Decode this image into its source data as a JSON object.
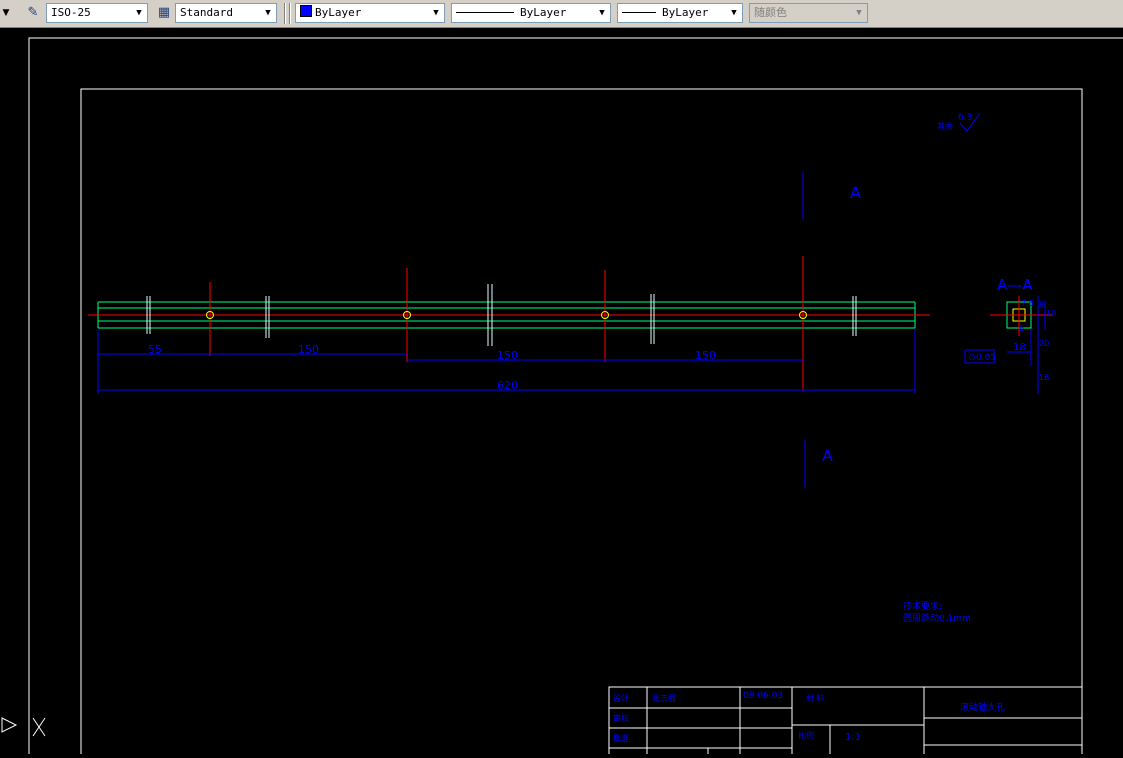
{
  "toolbar": {
    "dim_style": "ISO-25",
    "table_style": "Standard",
    "color": "ByLayer",
    "linetype": "ByLayer",
    "lineweight": "ByLayer",
    "plot_style": "随颜色",
    "layer_color_hex": "#0000ff"
  },
  "drawing": {
    "section_mark_top": "A",
    "section_mark_bottom": "A",
    "section_title": "A—A",
    "roughness_note": "其余",
    "roughness_value": "6.3",
    "dim_1": "55",
    "dim_2": "150",
    "dim_3": "150",
    "dim_4": "150",
    "dim_total": "620",
    "section_dim_width": "18",
    "section_tolerance": "0.05",
    "section_dim_1": "7.6",
    "section_dim_2": "6",
    "section_dim_3": "8",
    "section_dim_4": "10",
    "section_dim_5": "20",
    "section_dim_6": "16",
    "tech_title": "技术要求:",
    "tech_line": "圆周跳动0.1mm",
    "title_block": {
      "design_label": "设计",
      "design_name": "张志强",
      "date": "08.06.03",
      "review_label": "审核",
      "approve_label": "批准",
      "material_label": "材  料",
      "scale_label": "比例",
      "scale_value": "1:1",
      "part_name": "滚动轴大孔"
    }
  }
}
